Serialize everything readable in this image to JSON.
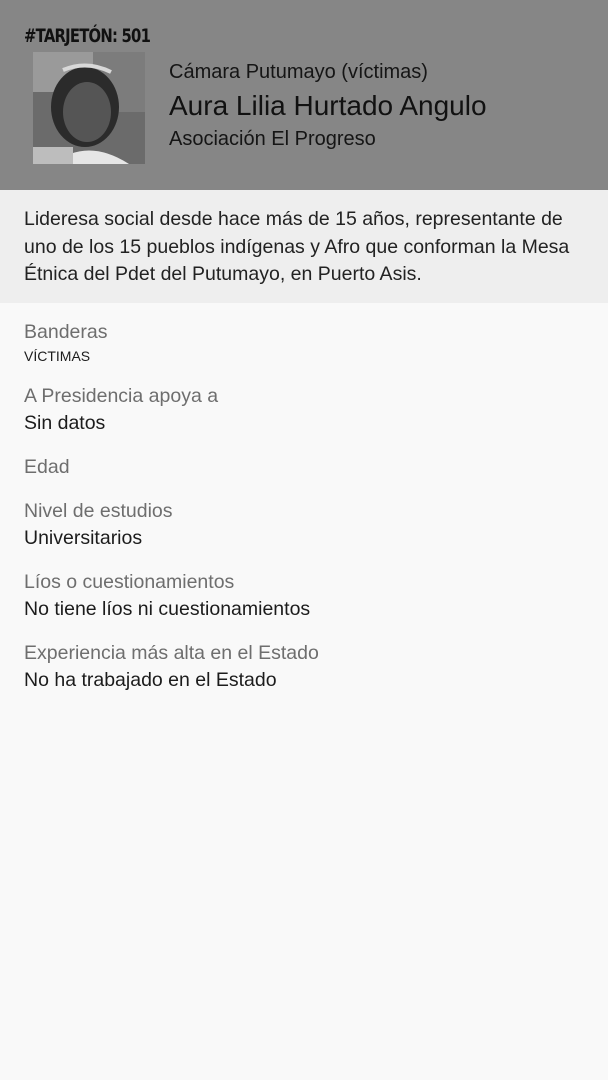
{
  "ballot_number": "#TARJETÓN: 501",
  "candidate": {
    "chamber": "Cámara Putumayo (víctimas)",
    "name": "Aura Lilia Hurtado Angulo",
    "party": "Asociación El Progreso",
    "photo_alt": "candidate-photo"
  },
  "bio": "Lideresa social desde hace más de 15 años, representante de uno de los 15 pueblos indígenas y Afro que conforman la Mesa Étnica del Pdet del Putumayo, en Puerto Asis.",
  "fields": {
    "banderas": {
      "label": "Banderas",
      "value": "VÍCTIMAS"
    },
    "presidencia": {
      "label": "A Presidencia apoya a",
      "value": "Sin datos"
    },
    "edad": {
      "label": "Edad",
      "value": ""
    },
    "estudios": {
      "label": "Nivel de estudios",
      "value": "Universitarios"
    },
    "lios": {
      "label": "Líos o cuestionamientos",
      "value": "No tiene líos ni cuestionamientos"
    },
    "experiencia": {
      "label": "Experiencia más alta en el Estado",
      "value": "No ha trabajado en el Estado"
    }
  },
  "colors": {
    "header_bg": "#868686",
    "bio_bg": "#eeeeee",
    "page_bg": "#f9f9f9",
    "label_gray": "#6e6e6e"
  }
}
